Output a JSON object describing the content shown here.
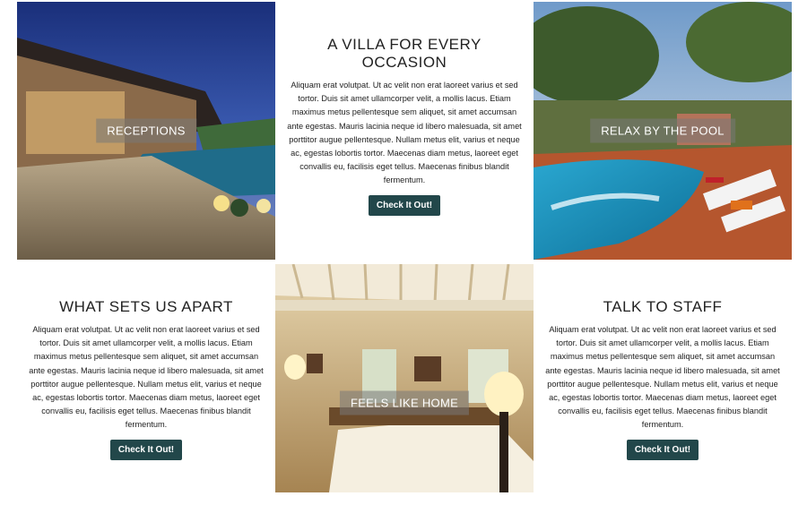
{
  "tiles": {
    "receptions": {
      "caption": "RECEPTIONS"
    },
    "villa": {
      "heading": "A VILLA FOR EVERY OCCASION",
      "body": "Aliquam erat volutpat. Ut ac velit non erat laoreet varius et sed tortor. Duis sit amet ullamcorper velit, a mollis lacus. Etiam maximus metus pellentesque sem aliquet, sit amet accumsan ante egestas. Mauris lacinia neque id libero malesuada, sit amet porttitor augue pellentesque. Nullam metus elit, varius et neque ac, egestas lobortis tortor. Maecenas diam metus, laoreet eget convallis eu, facilisis eget tellus. Maecenas finibus blandit fermentum.",
      "button": "Check It Out!"
    },
    "pool": {
      "caption": "RELAX BY THE POOL"
    },
    "apart": {
      "heading": "WHAT SETS US APART",
      "body": "Aliquam erat volutpat. Ut ac velit non erat laoreet varius et sed tortor. Duis sit amet ullamcorper velit, a mollis lacus. Etiam maximus metus pellentesque sem aliquet, sit amet accumsan ante egestas. Mauris lacinia neque id libero malesuada, sit amet porttitor augue pellentesque. Nullam metus elit, varius et neque ac, egestas lobortis tortor. Maecenas diam metus, laoreet eget convallis eu, facilisis eget tellus. Maecenas finibus blandit fermentum.",
      "button": "Check It Out!"
    },
    "home": {
      "caption": "FEELS LIKE HOME"
    },
    "staff": {
      "heading": "TALK TO STAFF",
      "body": "Aliquam erat volutpat. Ut ac velit non erat laoreet varius et sed tortor. Duis sit amet ullamcorper velit, a mollis lacus. Etiam maximus metus pellentesque sem aliquet, sit amet accumsan ante egestas. Mauris lacinia neque id libero malesuada, sit amet porttitor augue pellentesque. Nullam metus elit, varius et neque ac, egestas lobortis tortor. Maecenas diam metus, laoreet eget convallis eu, facilisis eget tellus. Maecenas finibus blandit fermentum.",
      "button": "Check It Out!"
    }
  },
  "colors": {
    "button": "#22474a",
    "caption_bg": "rgba(120,120,120,0.55)"
  }
}
